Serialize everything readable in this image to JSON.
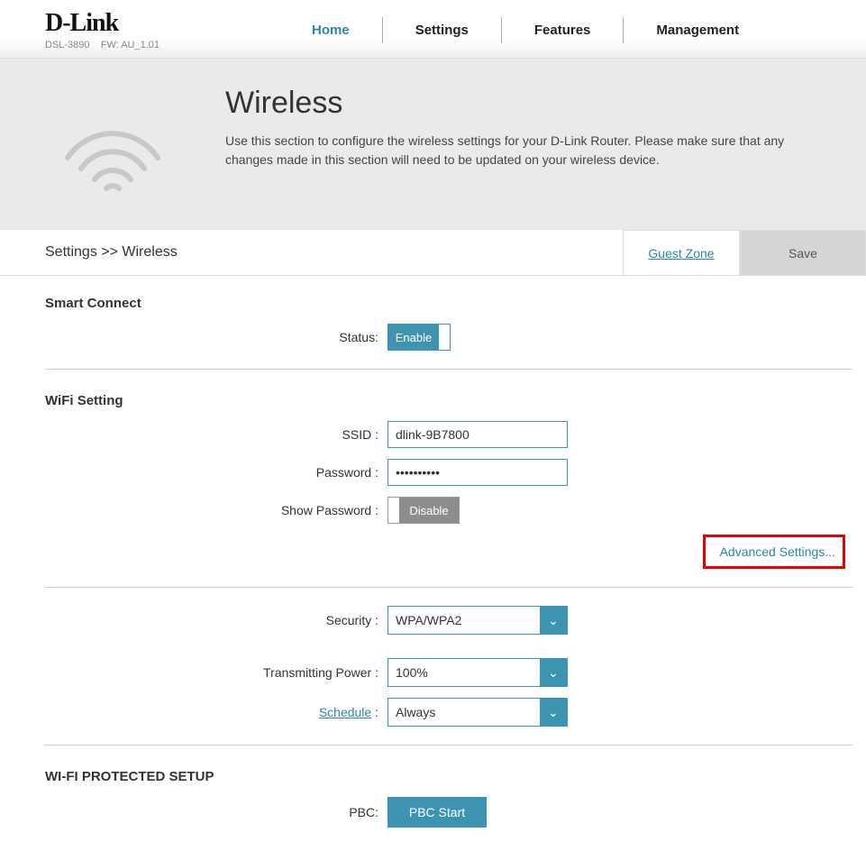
{
  "header": {
    "brand": "D-Link",
    "model": "DSL-3890",
    "fw": "FW: AU_1.01",
    "nav": {
      "home": "Home",
      "settings": "Settings",
      "features": "Features",
      "management": "Management"
    }
  },
  "banner": {
    "title": "Wireless",
    "desc": "Use this section to configure the wireless settings for your D-Link Router. Please make sure that any changes made in this section will need to be updated on your wireless device."
  },
  "crumb": "Settings >> Wireless",
  "tabs": {
    "guest": "Guest Zone",
    "save": "Save"
  },
  "smart": {
    "title": "Smart Connect",
    "status_label": "Status:",
    "enable": "Enable"
  },
  "wifi": {
    "title": "WiFi Setting",
    "ssid_label": "SSID :",
    "ssid_value": "dlink-9B7800",
    "pw_label": "Password :",
    "pw_value": "••••••••••",
    "showpw_label": "Show Password :",
    "disable": "Disable",
    "adv": "Advanced Settings...",
    "security_label": "Security :",
    "security_value": "WPA/WPA2",
    "tx_label": "Transmitting Power :",
    "tx_value": "100%",
    "sched_label": "Schedule",
    "sched_value": "Always"
  },
  "wps": {
    "title": "WI-FI PROTECTED SETUP",
    "pbc_label": "PBC:",
    "pbc_btn": "PBC Start"
  }
}
